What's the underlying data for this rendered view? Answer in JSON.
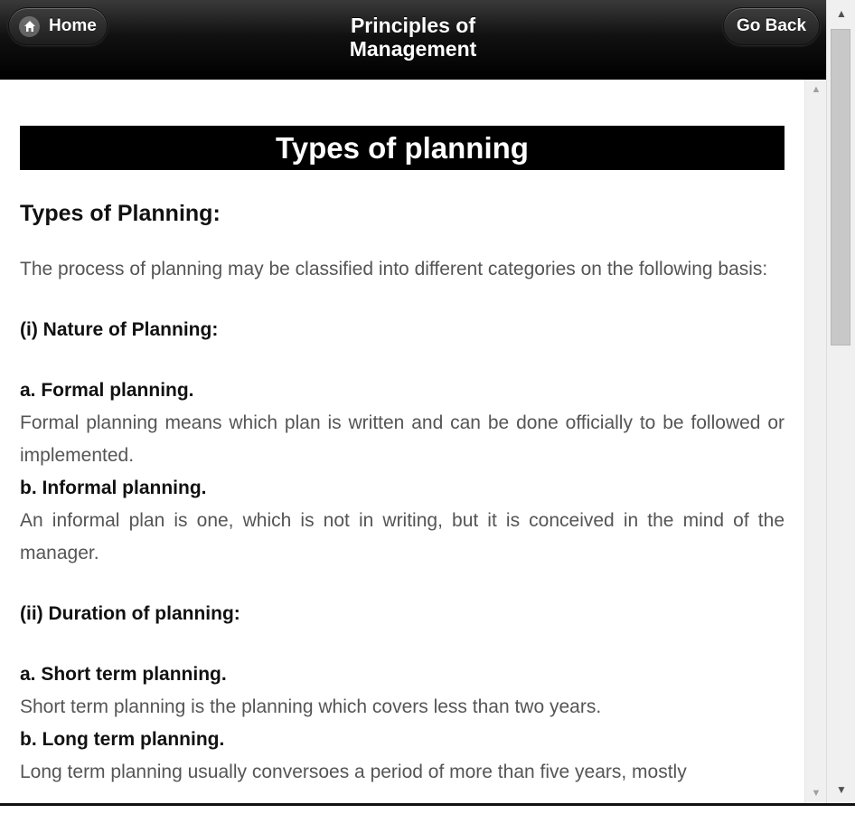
{
  "header": {
    "title_line1": "Principles of",
    "title_line2": "Management",
    "home_label": "Home",
    "back_label": "Go Back"
  },
  "content": {
    "banner": "Types of planning",
    "heading": "Types of Planning:",
    "intro": "The process of planning may be classified into different categories on the following basis:",
    "section1_title": "(i) Nature of Planning:",
    "item_a_title": "a. Formal planning.",
    "item_a_text": "Formal planning means which plan is written and can be done officially to be followed or implemented.",
    "item_b_title": "b. Informal planning.",
    "item_b_text": "An informal plan is one, which is not in writing, but it is conceived in the mind of the manager.",
    "section2_title": "(ii) Duration of planning:",
    "item_c_title": "a. Short term planning.",
    "item_c_text": "Short term planning is the planning which covers less than two years.",
    "item_d_title": "b. Long term planning.",
    "item_d_text": "Long term planning usually conversoes a period of more than five years, mostly"
  },
  "icons": {
    "home": "home-icon",
    "scroll_up": "scroll-up-arrow-icon",
    "scroll_down": "scroll-down-arrow-icon"
  }
}
